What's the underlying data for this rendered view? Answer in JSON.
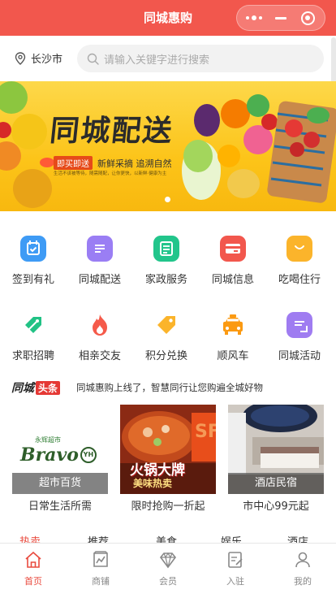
{
  "navbar": {
    "title": "同城惠购"
  },
  "location": {
    "city": "长沙市"
  },
  "search": {
    "placeholder": "请输入关键字进行搜索"
  },
  "banner": {
    "title": "同城配送",
    "buy_badge": "即买即送",
    "tagline": "新鲜采摘 追溯自然",
    "subtext": "生活不该被等待，随需随配，让你更快，以新鲜·健康为主"
  },
  "categories": [
    {
      "label": "签到有礼",
      "icon": "calendar-check-icon",
      "color": "#3e9bf5"
    },
    {
      "label": "同城配送",
      "icon": "list-card-icon",
      "color": "#9a7ef4"
    },
    {
      "label": "家政服务",
      "icon": "document-list-icon",
      "color": "#22c58b"
    },
    {
      "label": "同城信息",
      "icon": "card-icon",
      "color": "#f2574d"
    },
    {
      "label": "吃喝住行",
      "icon": "shopping-bag-icon",
      "color": "#fbb42b"
    },
    {
      "label": "求职招聘",
      "icon": "tag-check-icon",
      "color": "#21c285"
    },
    {
      "label": "相亲交友",
      "icon": "flame-icon",
      "color": "#f55a4a"
    },
    {
      "label": "积分兑换",
      "icon": "price-tag-icon",
      "color": "#fbb42b"
    },
    {
      "label": "顺风车",
      "icon": "taxi-icon",
      "color": "#fb9a12"
    },
    {
      "label": "同城活动",
      "icon": "clipboard-icon",
      "color": "#9f7cf1"
    }
  ],
  "headline": {
    "logo": "同城",
    "logo_badge": "头条",
    "text": "同城惠购上线了，智慧同行让您购遍全城好物"
  },
  "promos": [
    {
      "overlay": "超市百货",
      "caption": "日常生活所需",
      "brand_cn": "永辉超市",
      "brand_en": "Bravo",
      "brand_mark": "YH"
    },
    {
      "overlay": "",
      "caption": "限时抢购一折起",
      "poster_title": "火锅大牌",
      "poster_sub": "美味热卖"
    },
    {
      "overlay": "酒店民宿",
      "caption": "市中心99元起"
    }
  ],
  "section_tabs": [
    "热卖",
    "推荐",
    "美食",
    "娱乐",
    "酒店"
  ],
  "tabbar": {
    "active": 0,
    "items": [
      {
        "label": "首页",
        "icon": "home-icon"
      },
      {
        "label": "商铺",
        "icon": "shop-icon"
      },
      {
        "label": "会员",
        "icon": "diamond-icon"
      },
      {
        "label": "入驻",
        "icon": "edit-icon"
      },
      {
        "label": "我的",
        "icon": "user-icon"
      }
    ]
  },
  "colors": {
    "brand": "#f2574d",
    "banner": "#fcc419",
    "tab_active": "#e94b3f"
  }
}
